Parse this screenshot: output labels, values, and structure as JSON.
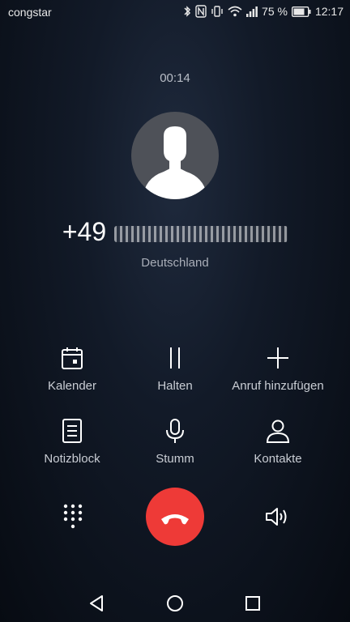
{
  "status_bar": {
    "carrier": "congstar",
    "battery_percent": "75 %",
    "time": "12:17",
    "icons": [
      "bluetooth-icon",
      "nfc-icon",
      "vibrate-icon",
      "wifi-icon",
      "signal-icon",
      "battery-icon"
    ]
  },
  "call": {
    "duration": "00:14",
    "number_prefix": "+49",
    "number_hidden": true,
    "location": "Deutschland"
  },
  "actions": [
    {
      "label": "Kalender",
      "icon": "calendar-icon"
    },
    {
      "label": "Halten",
      "icon": "pause-icon"
    },
    {
      "label": "Anruf hinzufügen",
      "icon": "plus-icon"
    },
    {
      "label": "Notizblock",
      "icon": "notepad-icon"
    },
    {
      "label": "Stumm",
      "icon": "microphone-icon"
    },
    {
      "label": "Kontakte",
      "icon": "contact-icon"
    }
  ],
  "bottom_controls": {
    "dialpad_icon": "dialpad-icon",
    "hangup_icon": "hangup-icon",
    "speaker_icon": "speaker-icon",
    "hangup_color": "#ee3a37"
  },
  "navigation": [
    "back-icon",
    "home-icon",
    "recents-icon"
  ]
}
